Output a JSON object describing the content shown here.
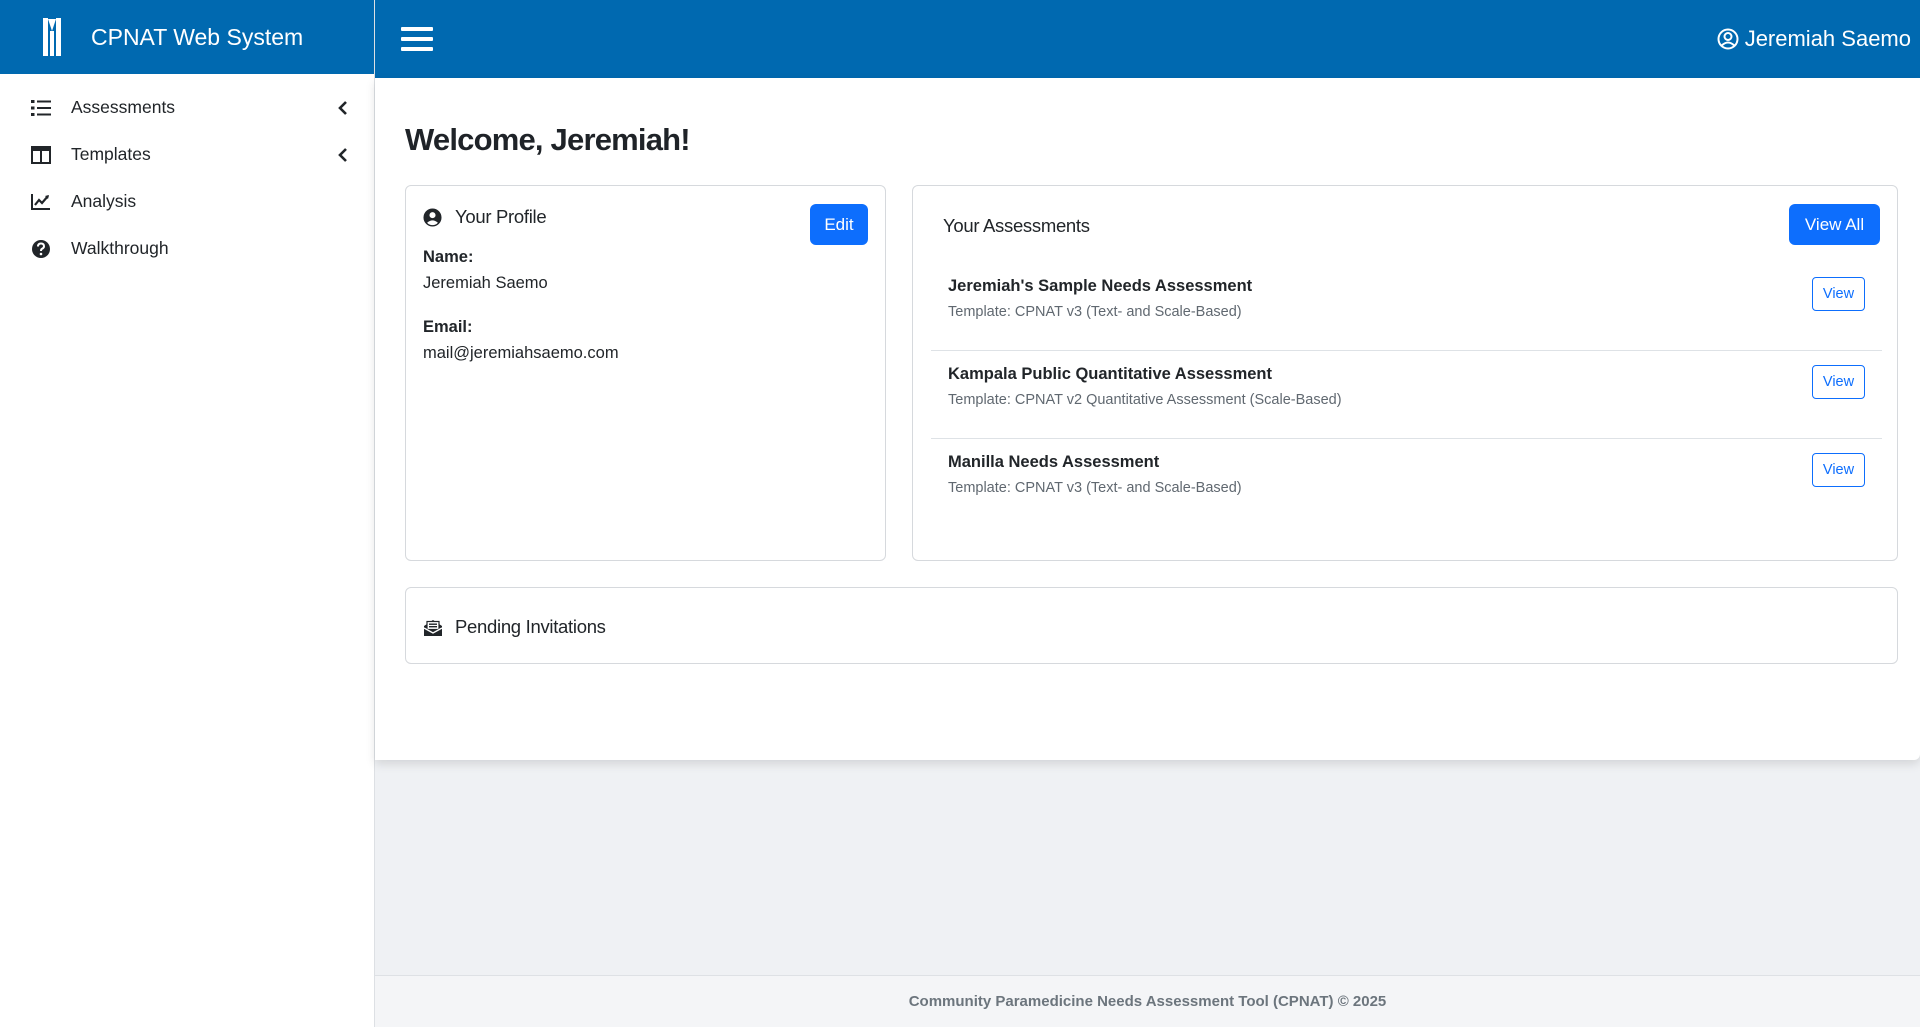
{
  "brand": {
    "title": "CPNAT Web System",
    "logo_icon": "cpnat-logo-icon"
  },
  "sidebar": {
    "items": [
      {
        "label": "Assessments",
        "icon": "list-icon",
        "has_submenu": true
      },
      {
        "label": "Templates",
        "icon": "columns-icon",
        "has_submenu": true
      },
      {
        "label": "Analysis",
        "icon": "chart-line-icon",
        "has_submenu": false
      },
      {
        "label": "Walkthrough",
        "icon": "question-circle-icon",
        "has_submenu": false
      }
    ]
  },
  "topbar": {
    "user_name": "Jeremiah Saemo",
    "menu_icon": "hamburger-icon",
    "user_icon": "user-circle-icon"
  },
  "main": {
    "welcome": "Welcome, Jeremiah!",
    "profile": {
      "title": "Your Profile",
      "edit_label": "Edit",
      "name_label": "Name:",
      "name_value": "Jeremiah Saemo",
      "email_label": "Email:",
      "email_value": "mail@jeremiahsaemo.com"
    },
    "assessments": {
      "title": "Your Assessments",
      "view_all_label": "View All",
      "view_label": "View",
      "items": [
        {
          "title": "Jeremiah's Sample Needs Assessment",
          "template": "Template: CPNAT v3 (Text- and Scale-Based)"
        },
        {
          "title": "Kampala Public Quantitative Assessment",
          "template": "Template: CPNAT v2 Quantitative Assessment (Scale-Based)"
        },
        {
          "title": "Manilla Needs Assessment",
          "template": "Template: CPNAT v3 (Text- and Scale-Based)"
        }
      ]
    },
    "invitations": {
      "title": "Pending Invitations"
    }
  },
  "footer": {
    "text": "Community Paramedicine Needs Assessment Tool (CPNAT) © 2025"
  },
  "colors": {
    "primary_bar": "#0069b0",
    "button": "#0d6efd"
  }
}
